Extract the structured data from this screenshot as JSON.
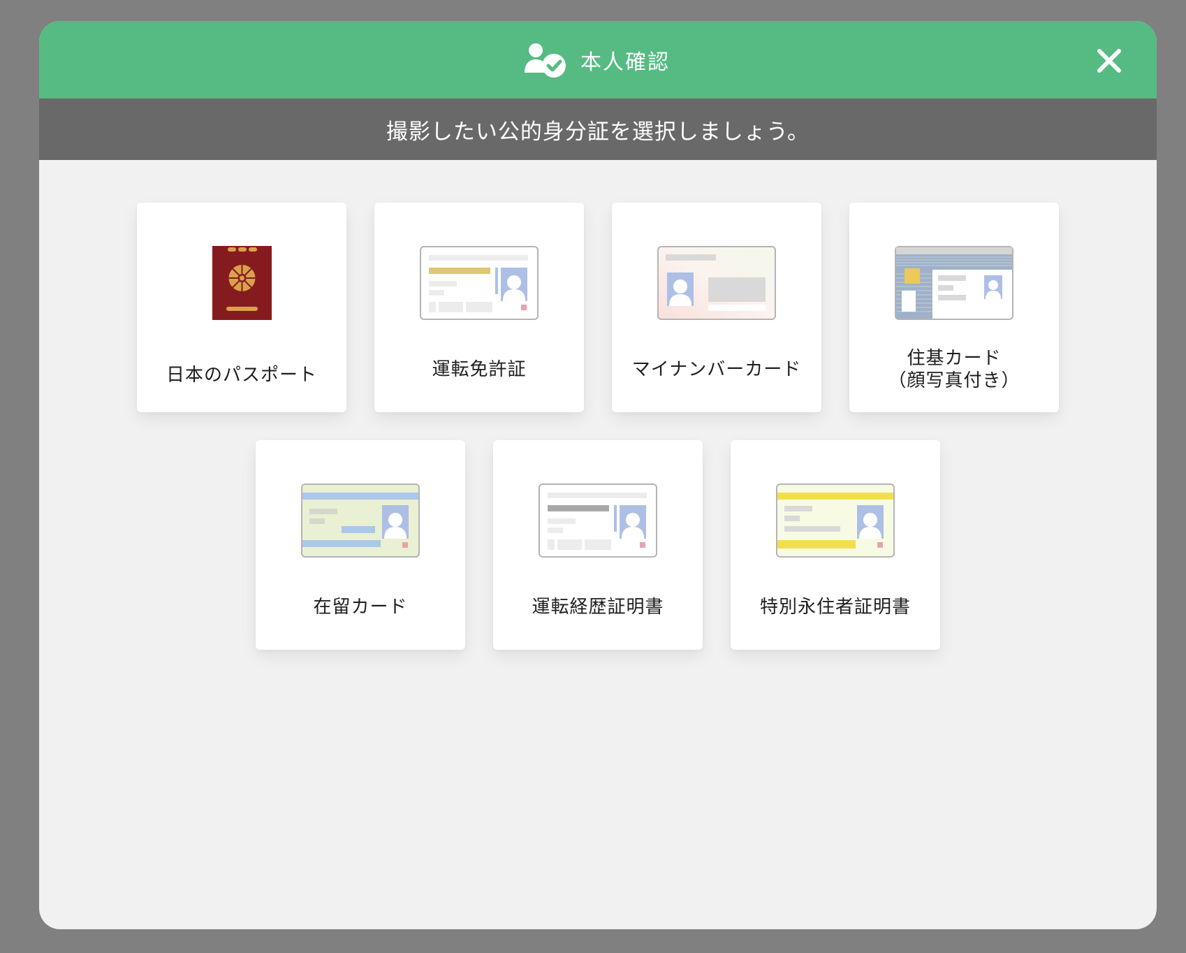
{
  "header": {
    "title": "本人確認",
    "icon": "user-check-icon",
    "close_icon": "close-icon",
    "color": "#56bb83"
  },
  "subheader": {
    "text": "撮影したい公的身分証を選択しましょう。"
  },
  "cards": [
    {
      "label": "日本のパスポート",
      "icon": "passport-icon"
    },
    {
      "label": "運転免許証",
      "icon": "drivers-license-icon"
    },
    {
      "label": "マイナンバーカード",
      "icon": "my-number-card-icon"
    },
    {
      "label": "住基カード\n（顔写真付き）",
      "icon": "resident-card-icon"
    },
    {
      "label": "在留カード",
      "icon": "residence-card-icon"
    },
    {
      "label": "運転経歴証明書",
      "icon": "driving-history-certificate-icon"
    },
    {
      "label": "特別永住者証明書",
      "icon": "special-permanent-resident-icon"
    }
  ]
}
